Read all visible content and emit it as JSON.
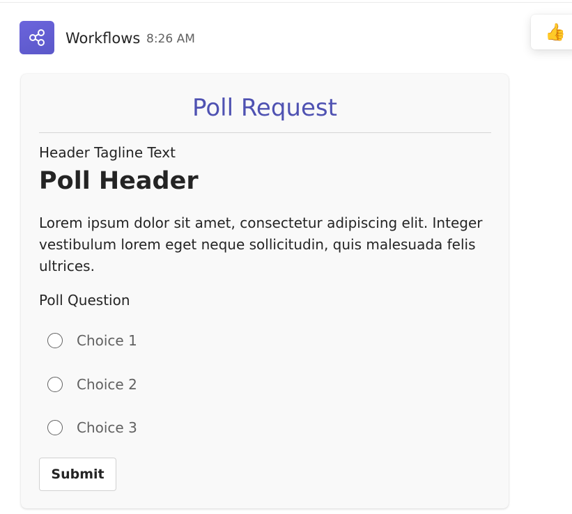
{
  "message": {
    "sender": "Workflows",
    "timestamp": "8:26 AM",
    "avatar_icon": "workflow-share-icon",
    "avatar_color": "#5b58c9"
  },
  "reaction": {
    "icon": "thumbs-up-icon",
    "emoji": "👍"
  },
  "card": {
    "title": "Poll Request",
    "title_color": "#4f52b2",
    "tagline": "Header Tagline Text",
    "header": "Poll Header",
    "body": "Lorem ipsum dolor sit amet, consectetur adipiscing elit. Integer vestibulum lorem eget neque sollicitudin, quis malesuada felis ultrices.",
    "question": "Poll Question",
    "choices": [
      {
        "label": "Choice 1",
        "selected": false
      },
      {
        "label": "Choice 2",
        "selected": false
      },
      {
        "label": "Choice 3",
        "selected": false
      }
    ],
    "submit_label": "Submit"
  }
}
